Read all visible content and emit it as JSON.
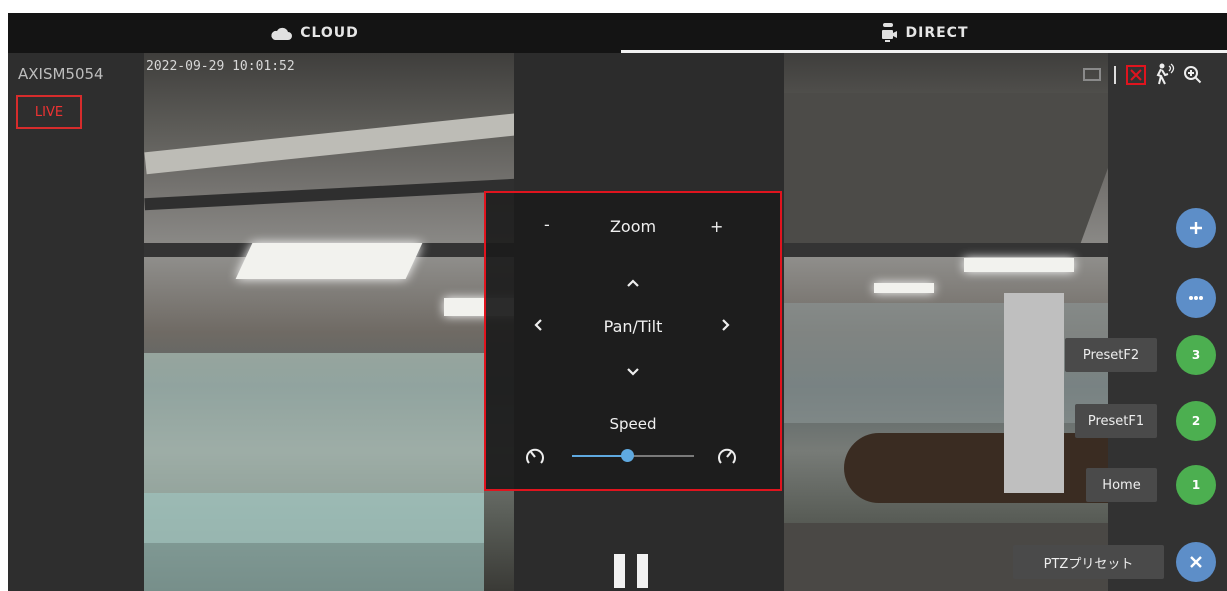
{
  "tabs": {
    "cloud": {
      "label": "CLOUD",
      "icon": "cloud-icon"
    },
    "direct": {
      "label": "DIRECT",
      "icon": "camera-icon",
      "active": true
    }
  },
  "camera": {
    "name": "AXISM5054",
    "live_label": "LIVE",
    "timestamp": "2022-09-29 10:01:52"
  },
  "toolbar": {
    "icons": [
      "screen-icon",
      "fullscreen-icon",
      "motion-detect-icon",
      "zoom-in-icon"
    ],
    "active_color": "#e0141e"
  },
  "ptz": {
    "zoom_minus": "-",
    "zoom_label": "Zoom",
    "zoom_plus": "+",
    "pan_tilt_label": "Pan/Tilt",
    "speed_label": "Speed",
    "speed_value": 0.45,
    "highlight_color": "#e0141e",
    "accent_color": "#5fa9e0"
  },
  "presets": {
    "items": [
      {
        "label": "PresetF2",
        "number": "3"
      },
      {
        "label": "PresetF1",
        "number": "2"
      },
      {
        "label": "Home",
        "number": "1"
      }
    ],
    "menu_label": "PTZプリセット",
    "green": "#4caf50",
    "blue": "#5d8ec8"
  }
}
